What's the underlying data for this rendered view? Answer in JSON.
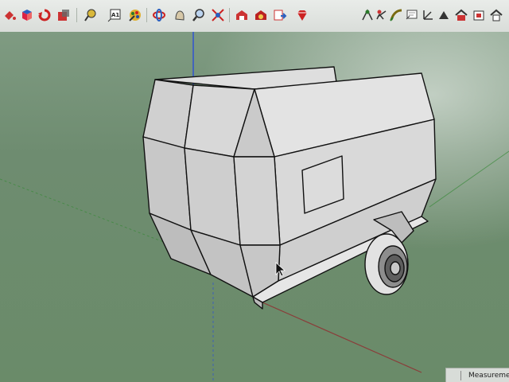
{
  "toolbar": {
    "tools_left": [
      {
        "name": "paint-bucket-icon"
      },
      {
        "name": "component-icon"
      },
      {
        "name": "rotate-icon"
      },
      {
        "name": "scale-icon"
      },
      {
        "name": "tape-measure-icon"
      },
      {
        "name": "text-icon",
        "label": "A1"
      },
      {
        "name": "paint-icon"
      },
      {
        "name": "orbit-icon"
      },
      {
        "name": "pan-icon"
      },
      {
        "name": "zoom-icon"
      },
      {
        "name": "zoom-extents-icon"
      },
      {
        "name": "warehouse-icon"
      },
      {
        "name": "extension-warehouse-icon"
      },
      {
        "name": "share-model-icon"
      },
      {
        "name": "ruby-icon"
      }
    ],
    "tools_right": [
      {
        "name": "position-camera-icon"
      },
      {
        "name": "walk-icon"
      },
      {
        "name": "look-around-icon"
      },
      {
        "name": "section-plane-icon"
      },
      {
        "name": "axes-icon"
      },
      {
        "name": "dimension-icon"
      },
      {
        "name": "house-view-icon"
      },
      {
        "name": "front-view-icon"
      }
    ]
  },
  "status": {
    "measurements_label": "Measurement"
  },
  "colors": {
    "background": "#6f8a72",
    "model_face": "#d6d6d6",
    "edge": "#111111",
    "blue_axis": "#2b4fd6",
    "red_axis": "#8a3d3a",
    "green_axis": "#3a8a3a"
  }
}
